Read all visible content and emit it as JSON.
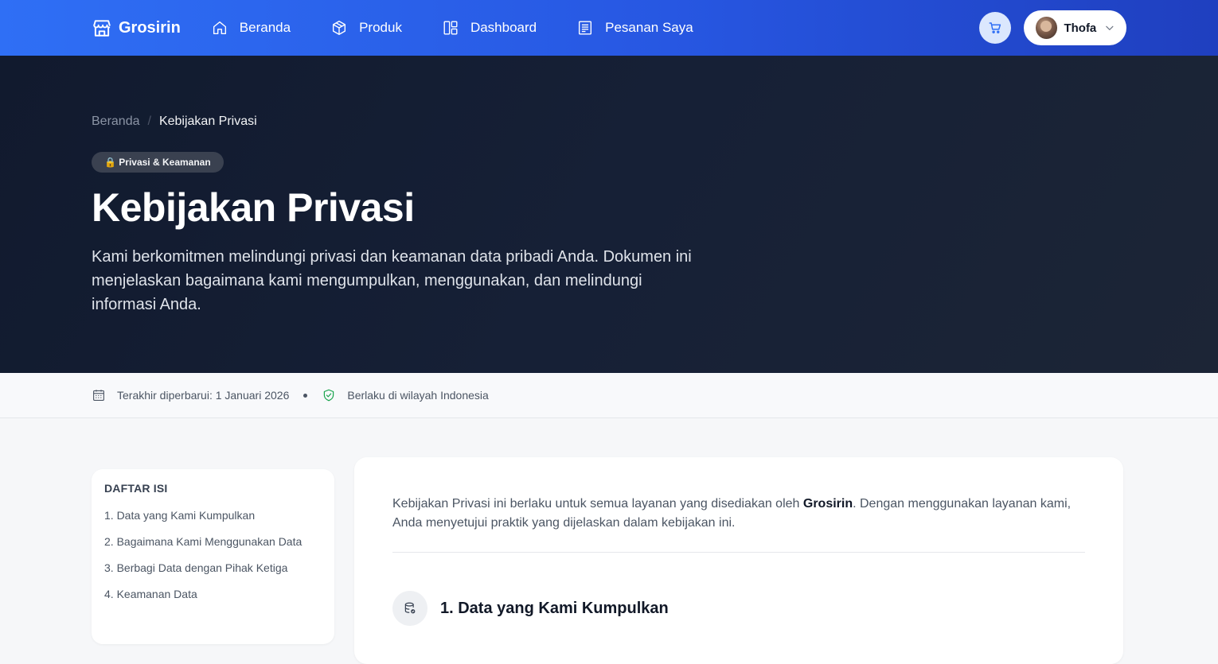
{
  "navbar": {
    "brand": "Grosirin",
    "links": [
      {
        "label": "Beranda",
        "icon": "home-icon"
      },
      {
        "label": "Produk",
        "icon": "box-icon"
      },
      {
        "label": "Dashboard",
        "icon": "dashboard-icon"
      },
      {
        "label": "Pesanan Saya",
        "icon": "receipt-icon"
      }
    ],
    "user_name": "Thofa"
  },
  "hero": {
    "breadcrumb": {
      "home": "Beranda",
      "separator": "/",
      "current": "Kebijakan Privasi"
    },
    "badge": "🔒 Privasi & Keamanan",
    "title": "Kebijakan Privasi",
    "description": "Kami berkomitmen melindungi privasi dan keamanan data pribadi Anda. Dokumen ini menjelaskan bagaimana kami mengumpulkan, menggunakan, dan melindungi informasi Anda."
  },
  "meta": {
    "updated": "Terakhir diperbarui: 1 Januari 2026",
    "region": "Berlaku di wilayah Indonesia"
  },
  "toc": {
    "title": "DAFTAR ISI",
    "items": [
      "1. Data yang Kami Kumpulkan",
      "2. Bagaimana Kami Menggunakan Data",
      "3. Berbagi Data dengan Pihak Ketiga",
      "4. Keamanan Data"
    ]
  },
  "article": {
    "intro_before": "Kebijakan Privasi ini berlaku untuk semua layanan yang disediakan oleh ",
    "intro_brand": "Grosirin",
    "intro_after": ". Dengan menggunakan layanan kami, Anda menyetujui praktik yang dijelaskan dalam kebijakan ini.",
    "section_1_title": "1. Data yang Kami Kumpulkan"
  },
  "colors": {
    "nav_start": "#2f6ff5",
    "nav_end": "#1f3fbf",
    "hero_bg": "#111a2e",
    "accent_green": "#16a34a"
  }
}
